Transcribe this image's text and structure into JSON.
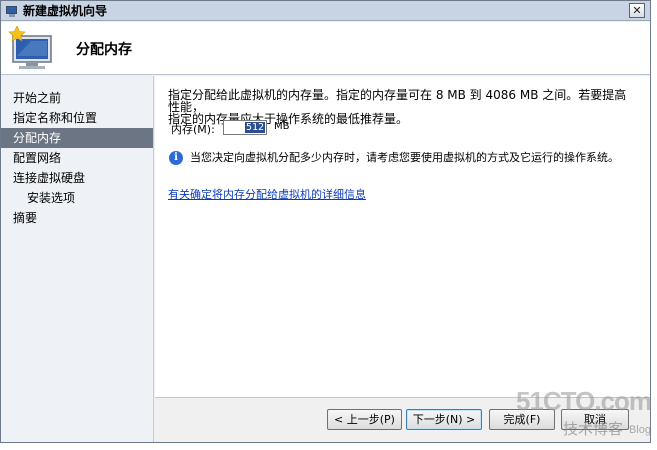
{
  "window": {
    "title": "新建虚拟机向导",
    "close_glyph": "✕"
  },
  "header": {
    "title": "分配内存"
  },
  "sidebar": {
    "items": [
      {
        "label": "开始之前",
        "level": 0,
        "active": false
      },
      {
        "label": "指定名称和位置",
        "level": 0,
        "active": false
      },
      {
        "label": "分配内存",
        "level": 0,
        "active": true
      },
      {
        "label": "配置网络",
        "level": 0,
        "active": false
      },
      {
        "label": "连接虚拟硬盘",
        "level": 0,
        "active": false
      },
      {
        "label": "安装选项",
        "level": 1,
        "active": false
      },
      {
        "label": "摘要",
        "level": 0,
        "active": false
      }
    ]
  },
  "main": {
    "intro_line1": "指定分配给此虚拟机的内存量。指定的内存量可在 8 MB 到 4086 MB 之间。若要提高性能，",
    "intro_line2": "指定的内存量应大于操作系统的最低推荐量。",
    "memory_label": "内存(M):",
    "memory_value": "512",
    "memory_unit": "MB",
    "info_icon": "info-icon",
    "info_text": "当您决定向虚拟机分配多少内存时，请考虑您要使用虚拟机的方式及它运行的操作系统。",
    "link_text": "有关确定将内存分配给虚拟机的详细信息"
  },
  "buttons": {
    "prev": "< 上一步(P)",
    "next": "下一步(N) >",
    "finish": "完成(F)",
    "cancel": "取消"
  },
  "watermark": {
    "site": "51CTO.com",
    "tagline": "技术博客",
    "blog": "Blog"
  },
  "colors": {
    "active_nav": "#6c7584",
    "link": "#0a3bb8",
    "selection": "#2c4f90"
  }
}
